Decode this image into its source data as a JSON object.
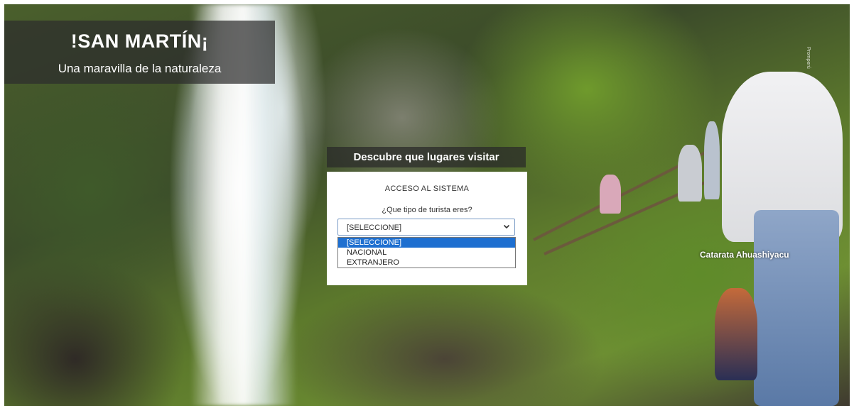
{
  "hero": {
    "title": "!SAN MARTÍN¡",
    "subtitle": "Una maravilla de la naturaleza",
    "photo_caption": "Catarata Ahuashiyacu",
    "photo_credit": "Promperú"
  },
  "discover": {
    "label": "Descubre que lugares visitar"
  },
  "login": {
    "title": "ACCESO AL SISTEMA",
    "question": "¿Que tipo de turista eres?",
    "select_value": "[SELECCIONE]",
    "options": [
      "[SELECCIONE]",
      "NACIONAL",
      "EXTRANJERO"
    ],
    "selected_index": 0
  },
  "colors": {
    "highlight": "#1e6fd0",
    "select_border": "#7a9cc6",
    "overlay": "#2d2d2d"
  }
}
